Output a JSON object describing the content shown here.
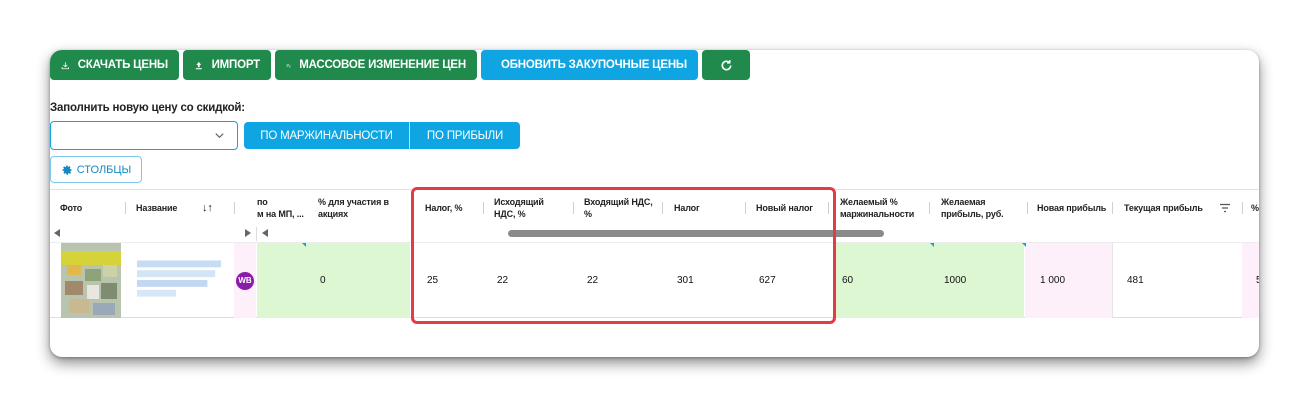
{
  "toolbar": {
    "download_label": "СКАЧАТЬ ЦЕНЫ",
    "import_label": "ИМПОРТ",
    "mass_change_label": "МАССОВОЕ ИЗМЕНЕНИЕ ЦЕН",
    "update_purchase_label": "ОБНОВИТЬ ЗАКУПОЧНЫЕ ЦЕНЫ"
  },
  "fill_label": "Заполнить новую цену со скидкой:",
  "discount_select": {
    "value": ""
  },
  "segments": {
    "by_margin": "ПО МАРЖИНАЛЬНОСТИ",
    "by_profit": "ПО ПРИБЫЛИ"
  },
  "columns_button": "СТОЛБЦЫ",
  "headers": {
    "photo": "Фото",
    "name": "Название",
    "mp_col_line1": "по",
    "mp_col_line2": "м на МП, ...",
    "promo_share": "% для участия в акциях",
    "tax_pct": "Налог, %",
    "outgoing_vat": "Исходящий НДС, %",
    "incoming_vat": "Входящий НДС, %",
    "tax": "Налог",
    "new_tax": "Новый налог",
    "desired_margin": "Желаемый % маржинальности",
    "desired_profit": "Желаемая прибыль, руб.",
    "new_profit": "Новая прибыль",
    "current_profit": "Текущая прибыль",
    "cut": "%"
  },
  "row": {
    "marketplace_badge": "WB",
    "promo_share": "0",
    "tax_pct": "25",
    "outgoing_vat": "22",
    "incoming_vat": "22",
    "tax": "301",
    "new_tax": "627",
    "desired_margin": "60",
    "desired_profit": "1000",
    "new_profit": "1 000",
    "current_profit": "481",
    "cut": "5"
  },
  "colors": {
    "green": "#1f8a4c",
    "blue": "#0ea5e2",
    "highlight": "#e53b46",
    "editable_cell": "#dcf7d2",
    "pink_cell": "#fdf0fa",
    "wb_badge": "#8b1ba8"
  }
}
